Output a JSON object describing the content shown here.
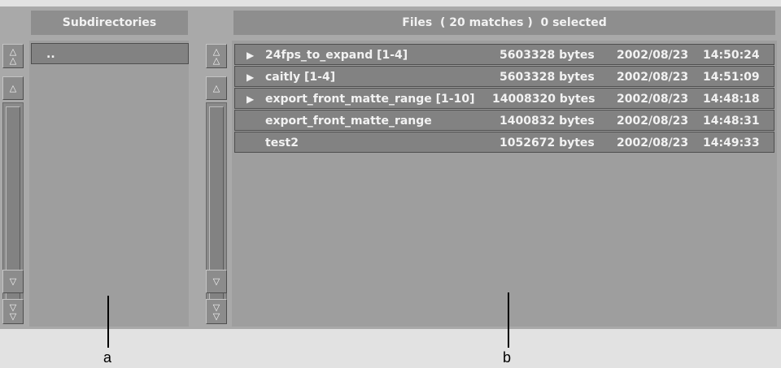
{
  "subdirectories": {
    "header": "Subdirectories",
    "items": [
      ".."
    ]
  },
  "files": {
    "header": "Files  ( 20 matches )  0 selected",
    "rows": [
      {
        "name": "24fps_to_expand [1-4]",
        "size": "5603328 bytes",
        "date": "2002/08/23",
        "time": "14:50:24",
        "expandable": true
      },
      {
        "name": "caitly [1-4]",
        "size": "5603328 bytes",
        "date": "2002/08/23",
        "time": "14:51:09",
        "expandable": true
      },
      {
        "name": "export_front_matte_range [1-10]",
        "size": "14008320 bytes",
        "date": "2002/08/23",
        "time": "14:48:18",
        "expandable": true
      },
      {
        "name": "export_front_matte_range",
        "size": "1400832 bytes",
        "date": "2002/08/23",
        "time": "14:48:31",
        "expandable": false
      },
      {
        "name": "test2",
        "size": "1052672 bytes",
        "date": "2002/08/23",
        "time": "14:49:33",
        "expandable": false
      }
    ]
  },
  "callouts": {
    "a": "a",
    "b": "b"
  },
  "icons": {
    "expand": "triangle-right-icon",
    "scroll_top": "double-up-arrow-icon",
    "scroll_up": "up-arrow-icon",
    "scroll_down": "down-arrow-icon",
    "scroll_bottom": "double-down-arrow-icon"
  }
}
